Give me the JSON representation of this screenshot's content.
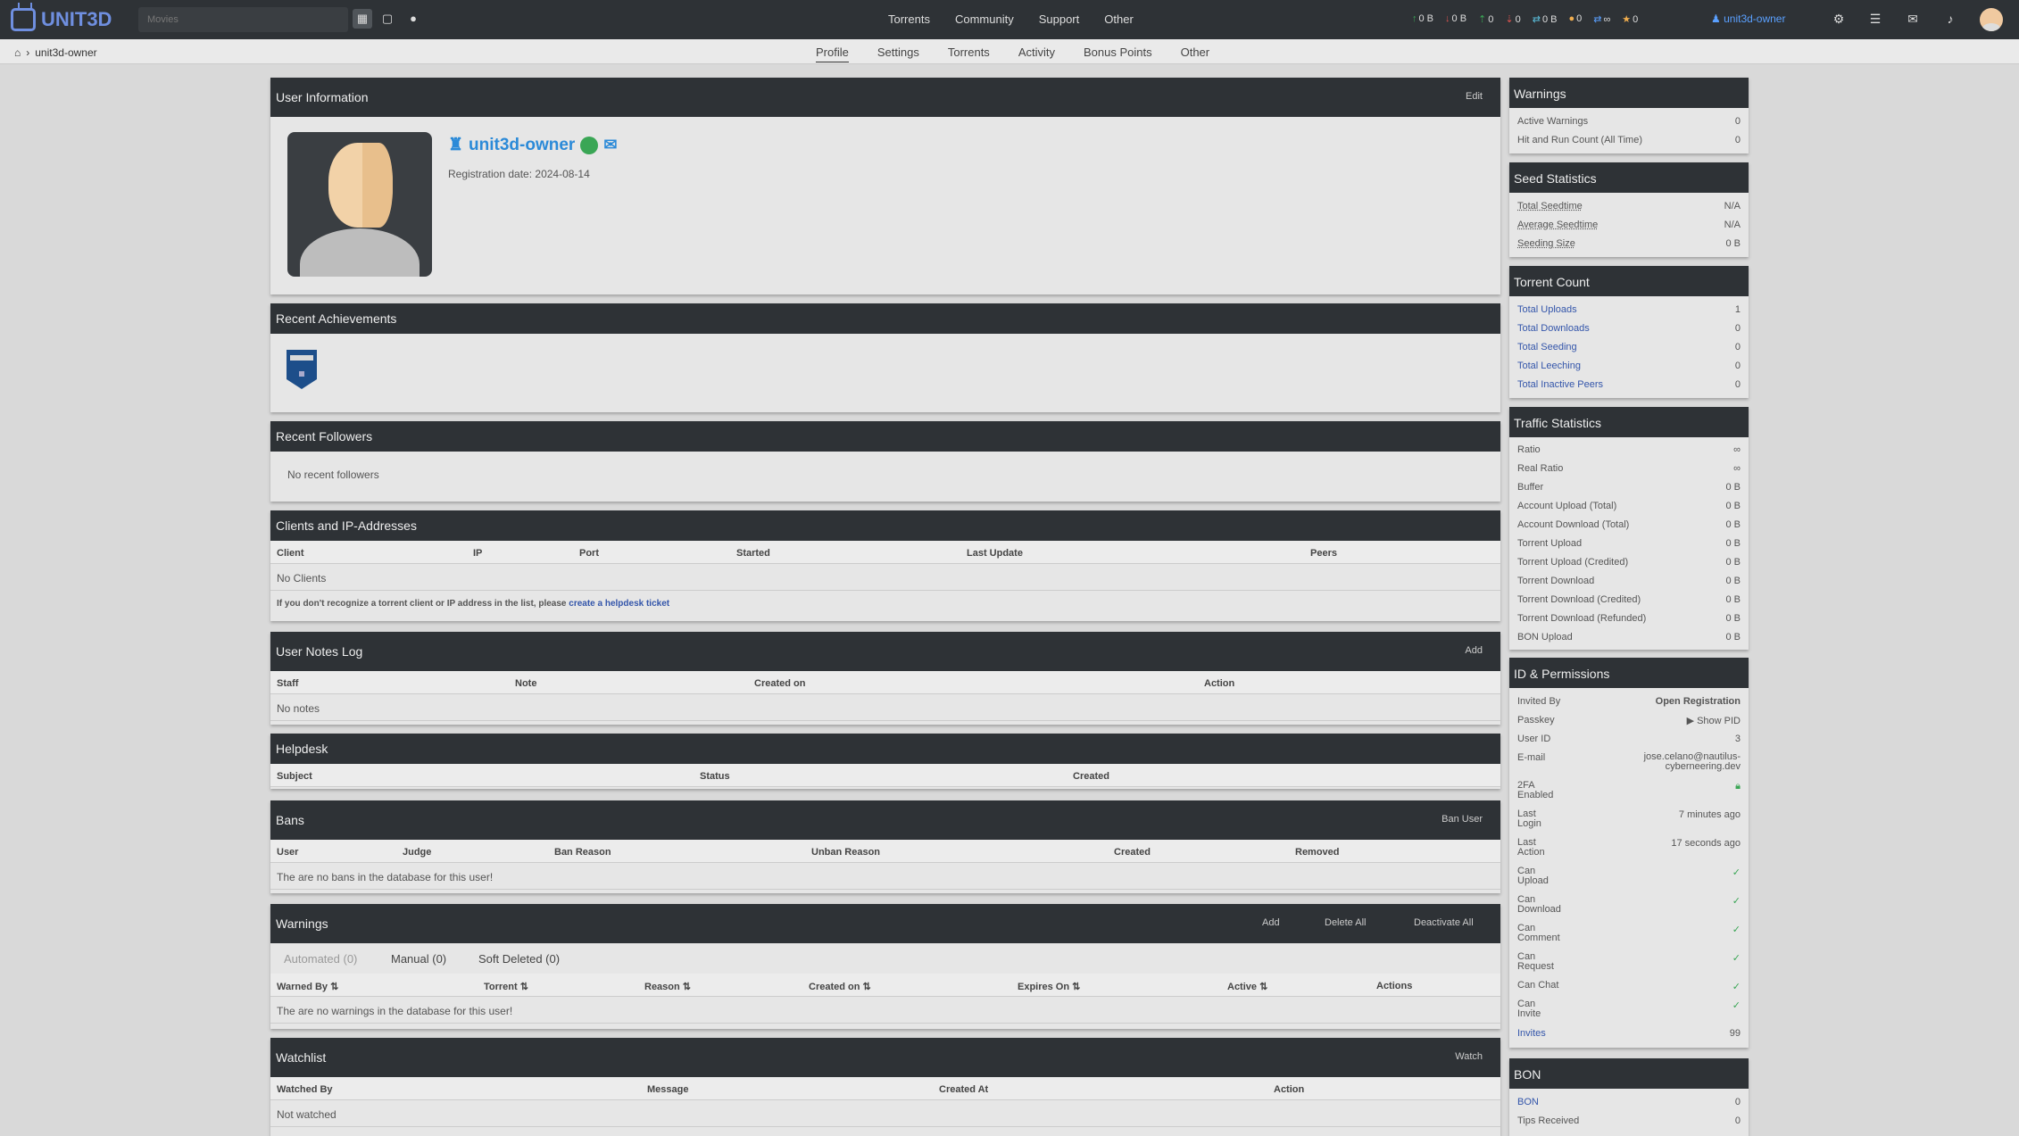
{
  "topbar": {
    "logo": "UNIT3D",
    "search_placeholder": "Movies",
    "nav": [
      "Torrents",
      "Community",
      "Support",
      "Other"
    ],
    "stats": [
      {
        "icon": "arrow-up-icon",
        "glyph": "↑",
        "value": "0 B",
        "color": "#3aa655"
      },
      {
        "icon": "arrow-down-icon",
        "glyph": "↓",
        "value": "0 B",
        "color": "#d9534f"
      },
      {
        "icon": "seed-icon",
        "glyph": "⇡",
        "value": "0",
        "color": "#3aa655"
      },
      {
        "icon": "leech-icon",
        "glyph": "⇣",
        "value": "0",
        "color": "#d9534f"
      },
      {
        "icon": "buffer-icon",
        "glyph": "⇄",
        "value": "0 B",
        "color": "#5bc0de"
      },
      {
        "icon": "coins-icon",
        "glyph": "●",
        "value": "0",
        "color": "#f0ad4e"
      },
      {
        "icon": "ratio-icon",
        "glyph": "⇄",
        "value": "∞",
        "color": "#5aa0ff"
      },
      {
        "icon": "star-icon",
        "glyph": "★",
        "value": "0",
        "color": "#f0ad4e"
      }
    ],
    "username": "unit3d-owner"
  },
  "breadcrumb": {
    "current": "unit3d-owner"
  },
  "subnav": [
    "Profile",
    "Settings",
    "Torrents",
    "Activity",
    "Bonus Points",
    "Other"
  ],
  "user_info": {
    "title": "User Information",
    "edit": "Edit",
    "username": "unit3d-owner",
    "registration": "Registration date: 2024-08-14"
  },
  "achievements": {
    "title": "Recent Achievements"
  },
  "followers": {
    "title": "Recent Followers",
    "empty": "No recent followers"
  },
  "clients": {
    "title": "Clients and IP-Addresses",
    "headers": [
      "Client",
      "IP",
      "Port",
      "Started",
      "Last Update",
      "Peers"
    ],
    "empty": "No Clients",
    "note": "If you don't recognize a torrent client or IP address in the list, please ",
    "note_link": "create a helpdesk ticket"
  },
  "notes": {
    "title": "User Notes Log",
    "add": "Add",
    "headers": [
      "Staff",
      "Note",
      "Created on",
      "Action"
    ],
    "empty": "No notes"
  },
  "helpdesk": {
    "title": "Helpdesk",
    "headers": [
      "Subject",
      "Status",
      "Created"
    ]
  },
  "bans": {
    "title": "Bans",
    "action": "Ban User",
    "headers": [
      "User",
      "Judge",
      "Ban Reason",
      "Unban Reason",
      "Created",
      "Removed"
    ],
    "empty": "The are no bans in the database for this user!"
  },
  "warnings_panel": {
    "title": "Warnings",
    "actions": [
      "Add",
      "Delete All",
      "Deactivate All"
    ],
    "tabs": [
      "Automated (0)",
      "Manual (0)",
      "Soft Deleted (0)"
    ],
    "headers": [
      "Warned By ⇅",
      "Torrent ⇅",
      "Reason ⇅",
      "Created on ⇅",
      "Expires On ⇅",
      "Active ⇅",
      "Actions"
    ],
    "empty": "The are no warnings in the database for this user!"
  },
  "watchlist": {
    "title": "Watchlist",
    "action": "Watch",
    "headers": [
      "Watched By",
      "Message",
      "Created At",
      "Action"
    ],
    "empty": "Not watched"
  },
  "side_warnings": {
    "title": "Warnings",
    "rows": [
      [
        "Active Warnings",
        "0"
      ],
      [
        "Hit and Run Count (All Time)",
        "0"
      ]
    ]
  },
  "seed_stats": {
    "title": "Seed Statistics",
    "rows": [
      [
        "Total Seedtime",
        "N/A"
      ],
      [
        "Average Seedtime",
        "N/A"
      ],
      [
        "Seeding Size",
        "0 B"
      ]
    ]
  },
  "torrent_count": {
    "title": "Torrent Count",
    "rows": [
      [
        "Total Uploads",
        "1"
      ],
      [
        "Total Downloads",
        "0"
      ],
      [
        "Total Seeding",
        "0"
      ],
      [
        "Total Leeching",
        "0"
      ],
      [
        "Total Inactive Peers",
        "0"
      ]
    ]
  },
  "traffic": {
    "title": "Traffic Statistics",
    "rows": [
      [
        "Ratio",
        "∞"
      ],
      [
        "Real Ratio",
        "∞"
      ],
      [
        "Buffer",
        "0 B"
      ],
      [
        "Account Upload (Total)",
        "0 B"
      ],
      [
        "Account Download (Total)",
        "0 B"
      ],
      [
        "Torrent Upload",
        "0 B"
      ],
      [
        "Torrent Upload (Credited)",
        "0 B"
      ],
      [
        "Torrent Download",
        "0 B"
      ],
      [
        "Torrent Download (Credited)",
        "0 B"
      ],
      [
        "Torrent Download (Refunded)",
        "0 B"
      ],
      [
        "BON Upload",
        "0 B"
      ]
    ]
  },
  "perms": {
    "title": "ID & Permissions",
    "invited_by": [
      "Invited By",
      "Open Registration"
    ],
    "passkey": [
      "Passkey",
      "▶ Show PID"
    ],
    "user_id": [
      "User ID",
      "3"
    ],
    "email": [
      "E-mail",
      "jose.celano@nautilus-",
      "cyberneering.dev"
    ],
    "twofa": [
      "2FA",
      "Enabled"
    ],
    "last_login": [
      "Last",
      "Login",
      "7 minutes ago"
    ],
    "last_action": [
      "Last",
      "Action",
      "17 seconds ago"
    ],
    "can": [
      [
        "Can",
        "Upload"
      ],
      [
        "Can",
        "Download"
      ],
      [
        "Can",
        "Comment"
      ],
      [
        "Can",
        "Request"
      ],
      [
        "Can Chat",
        ""
      ],
      [
        "Can",
        "Invite"
      ]
    ],
    "check": "✓",
    "invites": [
      "Invites",
      "99"
    ]
  },
  "bon": {
    "title": "BON",
    "rows": [
      [
        "BON",
        "0"
      ],
      [
        "Tips Received",
        "0"
      ]
    ]
  }
}
